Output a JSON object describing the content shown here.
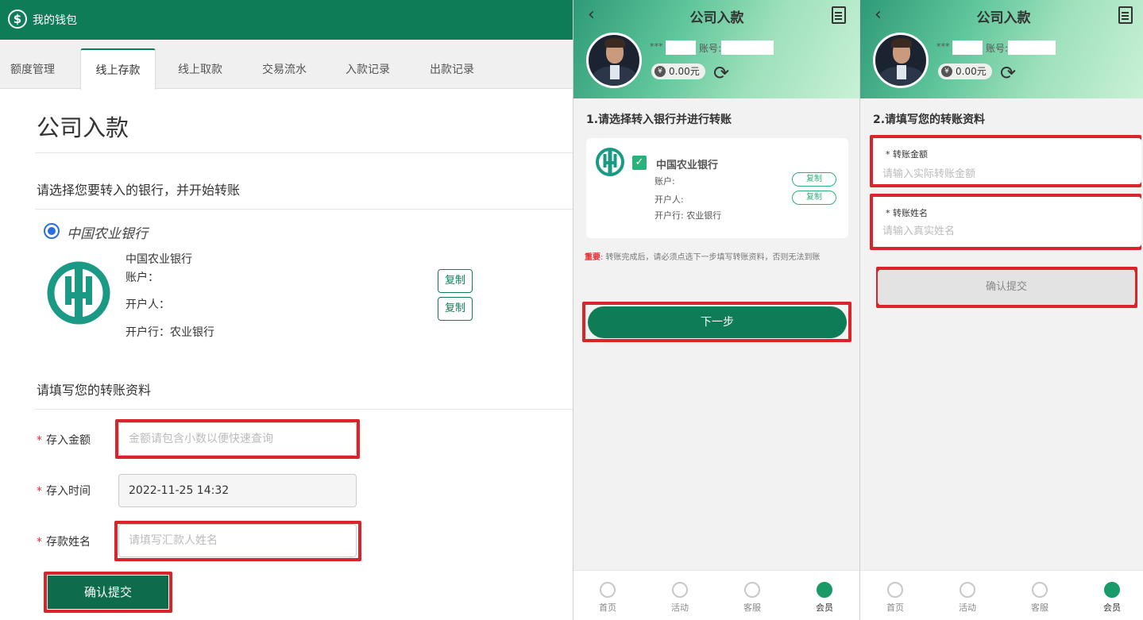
{
  "desktop": {
    "app_title": "我的钱包",
    "tabs": [
      "额度管理",
      "线上存款",
      "线上取款",
      "交易流水",
      "入款记录",
      "出款记录"
    ],
    "active_tab": "线上存款",
    "page_title": "公司入款",
    "select_bank_prompt": "请选择您要转入的银行，并开始转账",
    "bank": {
      "radio_label": "中国农业银行",
      "name": "中国农业银行",
      "account_label": "账户：",
      "holder_label": "开户人：",
      "branch_label": "开户行：农业银行",
      "copy_label": "复制"
    },
    "form_title": "请填写您的转账资料",
    "fields": {
      "amount": {
        "label": "存入金额",
        "placeholder": "金额请包含小数以便快速查询"
      },
      "time": {
        "label": "存入时间",
        "value": "2022-11-25 14:32"
      },
      "name": {
        "label": "存款姓名",
        "placeholder": "请填写汇款人姓名"
      }
    },
    "submit_label": "确认提交"
  },
  "mobile1": {
    "title": "公司入款",
    "masked_user": "***",
    "account_label": "账号:",
    "balance": "0.00元",
    "step_title": "1.请选择转入银行并进行转账",
    "bank": {
      "name": "中国农业银行",
      "account_label": "账户:",
      "holder_label": "开户人:",
      "branch_label": "开户行: 农业银行",
      "copy_label": "复制"
    },
    "note_important": "重要",
    "note_text": ": 转账完成后，请必须点选下一步填写转账资料，否则无法到账",
    "next_label": "下一步"
  },
  "mobile2": {
    "title": "公司入款",
    "masked_user": "***",
    "account_label": "账号:",
    "balance": "0.00元",
    "step_title": "2.请填写您的转账资料",
    "amount_label": "* 转账金额",
    "amount_placeholder": "请输入实际转账金额",
    "name_label": "* 转账姓名",
    "name_placeholder": "请输入真实姓名",
    "confirm_label": "确认提交"
  },
  "tabbar": [
    "首页",
    "活动",
    "客服",
    "会员"
  ],
  "colors": {
    "brand_green": "#0e7d57",
    "highlight_red": "#d9242b"
  }
}
